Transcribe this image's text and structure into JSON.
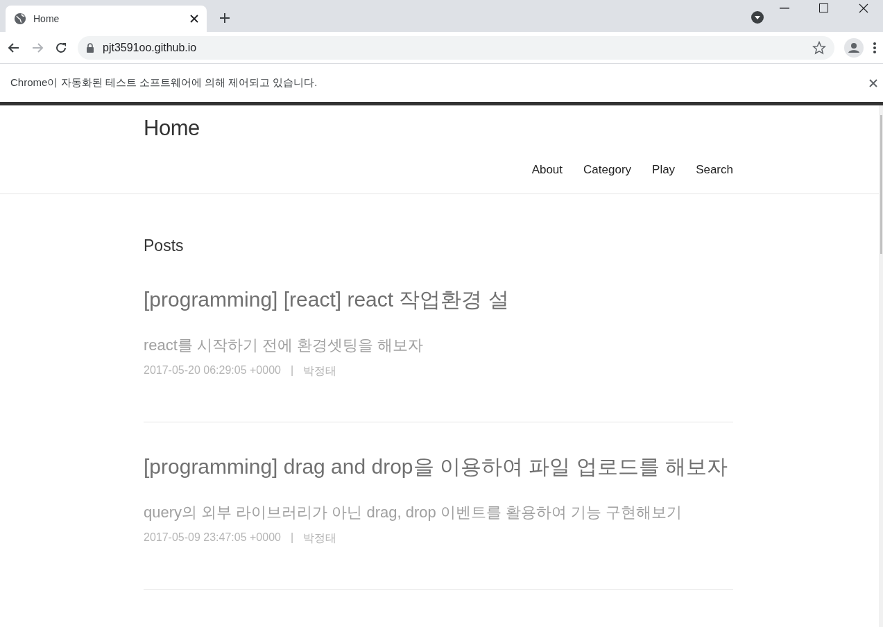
{
  "browser": {
    "tab": {
      "title": "Home",
      "selected": true
    },
    "address": "pjt3591oo.github.io",
    "infobar": "Chrome이 자동화된 테스트 소프트웨어에 의해 제어되고 있습니다."
  },
  "site": {
    "title": "Home",
    "nav": [
      "About",
      "Category",
      "Play",
      "Search"
    ]
  },
  "posts_heading": "Posts",
  "posts": [
    {
      "title": "[programming] [react] react 작업환경 설",
      "subtitle": "react를 시작하기 전에 환경셋팅을 해보자",
      "date": "2017-05-20 06:29:05 +0000",
      "separator": "|",
      "author": "박정태"
    },
    {
      "title": "[programming] drag and drop을 이용하여 파일 업로드를 해보자",
      "subtitle": "query의 외부 라이브러리가 아닌 drag, drop 이벤트를 활용하여 기능 구현해보기",
      "date": "2017-05-09 23:47:05 +0000",
      "separator": "|",
      "author": "박정태"
    }
  ]
}
